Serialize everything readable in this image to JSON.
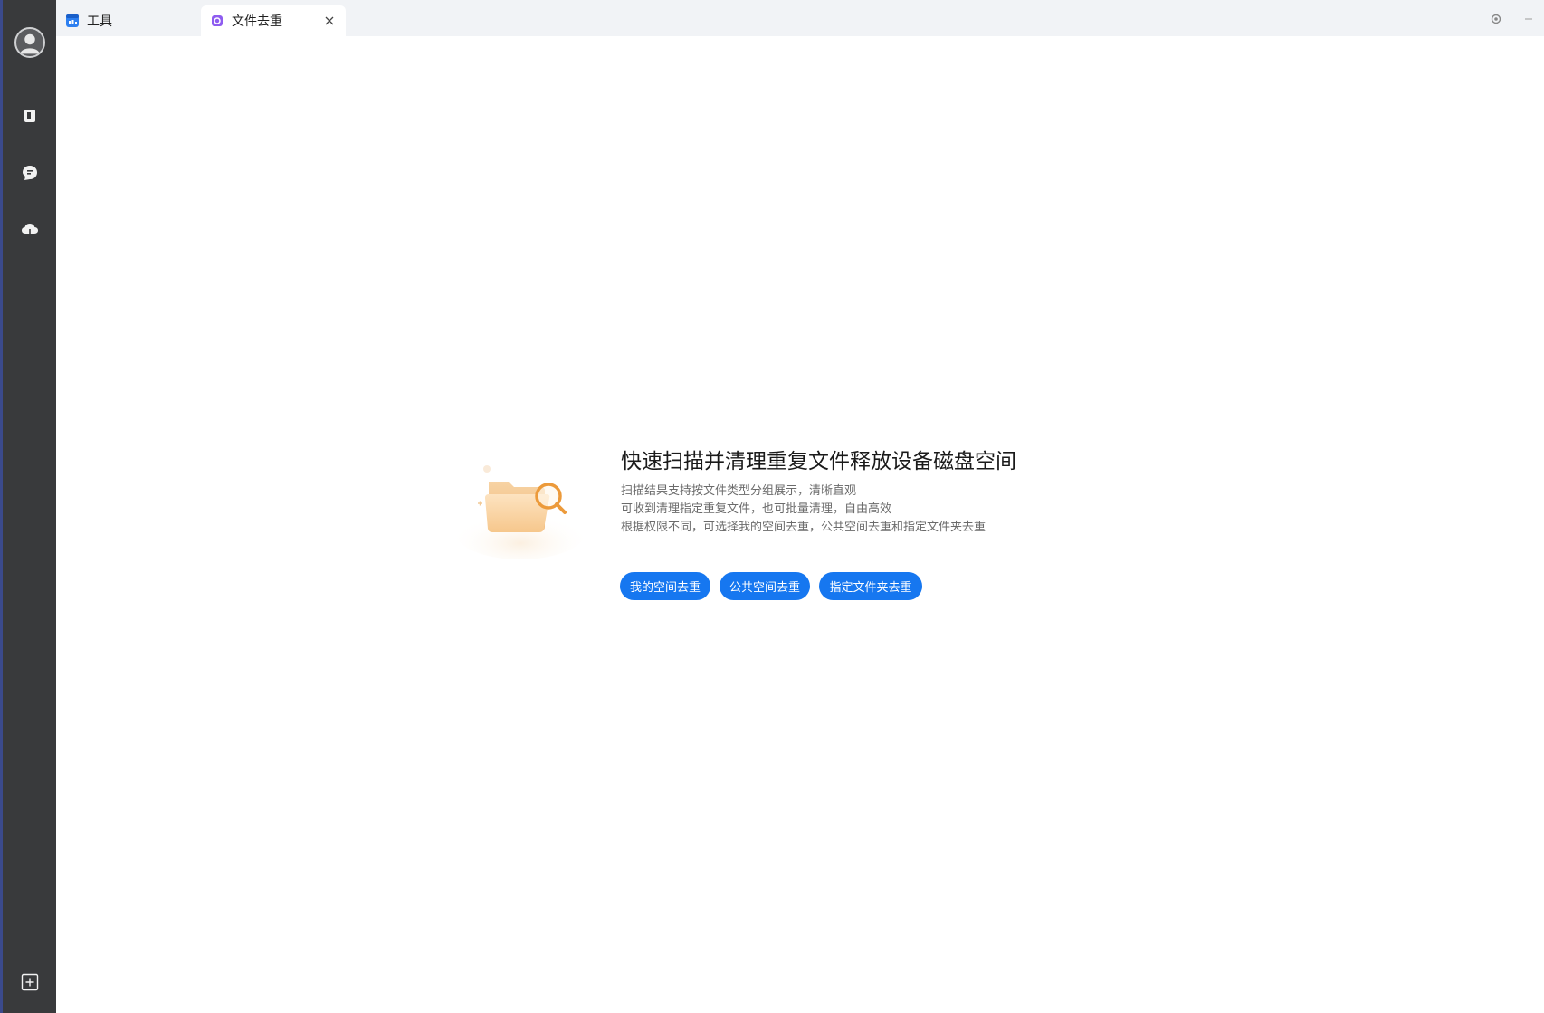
{
  "tabs": [
    {
      "label": "工具",
      "icon": "tools-app-icon",
      "active": false
    },
    {
      "label": "文件去重",
      "icon": "dedup-app-icon",
      "active": true
    }
  ],
  "sidebar": {
    "items": [
      {
        "icon": "avatar-icon"
      },
      {
        "icon": "documents-icon"
      },
      {
        "icon": "chat-icon"
      },
      {
        "icon": "cloud-icon"
      },
      {
        "icon": "add-app-icon"
      }
    ]
  },
  "window_controls": [
    "settings-icon",
    "minimize-icon",
    "maximize-icon",
    "close-icon"
  ],
  "main": {
    "title": "快速扫描并清理重复文件释放设备磁盘空间",
    "descriptions": [
      "扫描结果支持按文件类型分组展示，清晰直观",
      "可收到清理指定重复文件，也可批量清理，自由高效",
      "根据权限不同，可选择我的空间去重，公共空间去重和指定文件夹去重"
    ],
    "buttons": [
      {
        "label": "我的空间去重"
      },
      {
        "label": "公共空间去重"
      },
      {
        "label": "指定文件夹去重"
      }
    ]
  },
  "colors": {
    "sidebar": "#393a3c",
    "accent": "#1677f0",
    "tabbar": "#f1f3f6"
  }
}
